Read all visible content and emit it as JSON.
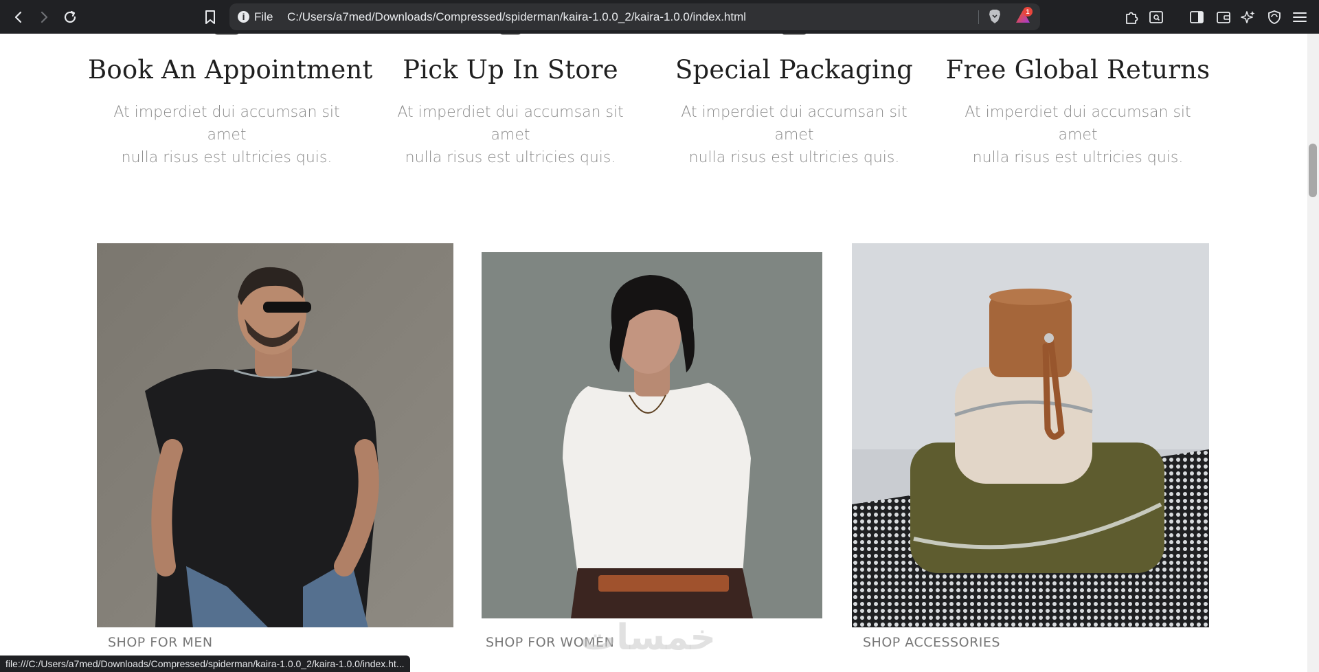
{
  "browser": {
    "scheme_label": "File",
    "url": "C:/Users/a7med/Downloads/Compressed/spiderman/kaira-1.0.0_2/kaira-1.0.0/index.html",
    "rewards_count": "1",
    "status_url": "file:///C:/Users/a7med/Downloads/Compressed/spiderman/kaira-1.0.0_2/kaira-1.0.0/index.ht..."
  },
  "features": [
    {
      "title": "Book An Appointment",
      "desc_line1": "At imperdiet dui accumsan sit amet",
      "desc_line2": "nulla risus est ultricies quis.",
      "icon": "calendar-icon"
    },
    {
      "title": "Pick Up In Store",
      "desc_line1": "At imperdiet dui accumsan sit amet",
      "desc_line2": "nulla risus est ultricies quis.",
      "icon": "shopping-bag-icon"
    },
    {
      "title": "Special Packaging",
      "desc_line1": "At imperdiet dui accumsan sit amet",
      "desc_line2": "nulla risus est ultricies quis.",
      "icon": "gift-icon"
    },
    {
      "title": "Free Global Returns",
      "desc_line1": "At imperdiet dui accumsan sit amet",
      "desc_line2": "nulla risus est ultricies quis.",
      "icon": "return-arrow-icon"
    }
  ],
  "categories": [
    {
      "label": "SHOP FOR MEN",
      "image": "man-in-black-tshirt-photo"
    },
    {
      "label": "SHOP FOR WOMEN",
      "image": "woman-in-white-top-photo"
    },
    {
      "label": "SHOP ACCESSORIES",
      "image": "leather-cases-photo"
    }
  ],
  "watermark": "خمسات",
  "colors": {
    "chrome_bg": "#202124",
    "omnibox_bg": "#303134",
    "title_text": "#1f1f1f",
    "desc_text": "#8b8b8b",
    "label_text": "#777777"
  }
}
